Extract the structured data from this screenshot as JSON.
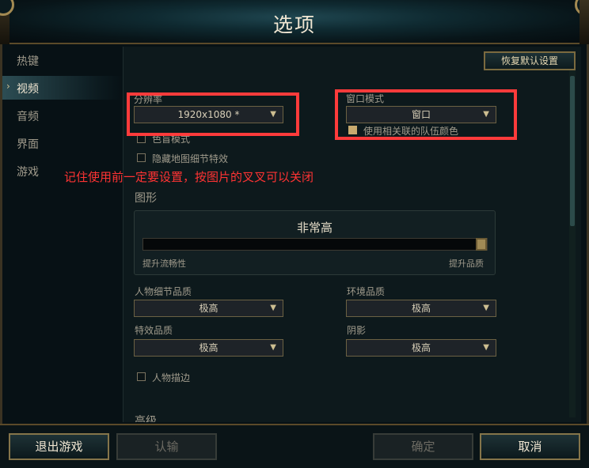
{
  "window": {
    "title": "选项"
  },
  "sidebar": {
    "items": [
      {
        "label": "热键"
      },
      {
        "label": "视频"
      },
      {
        "label": "音频"
      },
      {
        "label": "界面"
      },
      {
        "label": "游戏"
      }
    ],
    "active_index": 1,
    "active_marker": "›"
  },
  "toolbar": {
    "reset_label": "恢复默认设置"
  },
  "video": {
    "resolution_label": "分辨率",
    "resolution_value": "1920x1080 *",
    "window_mode_label": "窗口模式",
    "window_mode_value": "窗口",
    "colorblind_label": "色盲模式",
    "colorblind_checked": false,
    "hide_map_detail_label": "隐藏地图细节特效",
    "hide_map_detail_checked": false,
    "team_color_label": "使用相关联的队伍颜色",
    "team_color_checked": true
  },
  "graphics": {
    "section_title": "图形",
    "quality_value": "非常高",
    "quality_level_fraction": 1.0,
    "slider_left_label": "提升流畅性",
    "slider_right_label": "提升品质",
    "character_quality_label": "人物细节品质",
    "character_quality_value": "极高",
    "environment_quality_label": "环境品质",
    "environment_quality_value": "极高",
    "effects_quality_label": "特效品质",
    "effects_quality_value": "极高",
    "shadow_label": "阴影",
    "shadow_value": "极高",
    "character_outline_label": "人物描边",
    "character_outline_checked": false
  },
  "advanced": {
    "section_title": "高级"
  },
  "annotation": {
    "text": "记住使用前一定要设置，按图片的叉叉可以关闭"
  },
  "footer": {
    "exit_label": "退出游戏",
    "surrender_label": "认输",
    "confirm_label": "确定",
    "cancel_label": "取消"
  },
  "icons": {
    "dropdown_arrow": "▼"
  },
  "colors": {
    "accent_gold": "#c8aa6e",
    "highlight_red": "#ff3b3b"
  }
}
